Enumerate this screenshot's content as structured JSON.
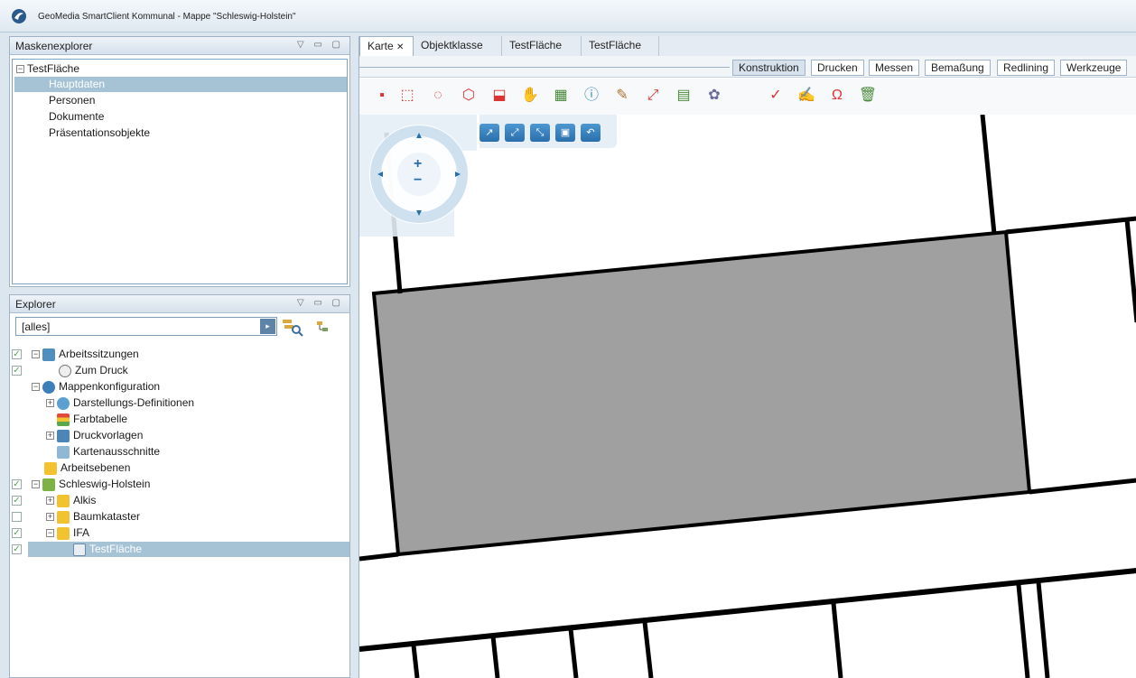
{
  "app": {
    "title": "GeoMedia SmartClient Kommunal - Mappe \"Schleswig-Holstein\""
  },
  "masken": {
    "title": "Maskenexplorer",
    "tools": "▽ ▭ ▢",
    "items": [
      {
        "label": "TestFläche"
      },
      {
        "label": "Hauptdaten"
      },
      {
        "label": "Personen"
      },
      {
        "label": "Dokumente"
      },
      {
        "label": "Präsentationsobjekte"
      }
    ]
  },
  "explorer": {
    "title": "Explorer",
    "tools": "▽ ▭ ▢",
    "filter_value": "[alles]",
    "items": [
      {
        "label": "Arbeitssitzungen"
      },
      {
        "label": "Zum Druck"
      },
      {
        "label": "Mappenkonfiguration"
      },
      {
        "label": "Darstellungs-Definitionen"
      },
      {
        "label": "Farbtabelle"
      },
      {
        "label": "Druckvorlagen"
      },
      {
        "label": "Kartenausschnitte"
      },
      {
        "label": "Arbeitsebenen"
      },
      {
        "label": "Schleswig-Holstein"
      },
      {
        "label": "Alkis"
      },
      {
        "label": "Baumkataster"
      },
      {
        "label": "IFA"
      },
      {
        "label": "TestFläche"
      }
    ]
  },
  "map": {
    "tabs": [
      "Karte",
      "Objektklasse",
      "TestFläche",
      "TestFläche"
    ],
    "ribbon": [
      "Konstruktion",
      "Drucken",
      "Messen",
      "Bemaßung",
      "Redlining",
      "Werkzeuge"
    ],
    "zoom_in": "+",
    "zoom_out": "−"
  },
  "colors": {
    "accent": "#2a6fab",
    "selection": "#a6c3d6",
    "parcel_fill": "#a0a0a0"
  }
}
